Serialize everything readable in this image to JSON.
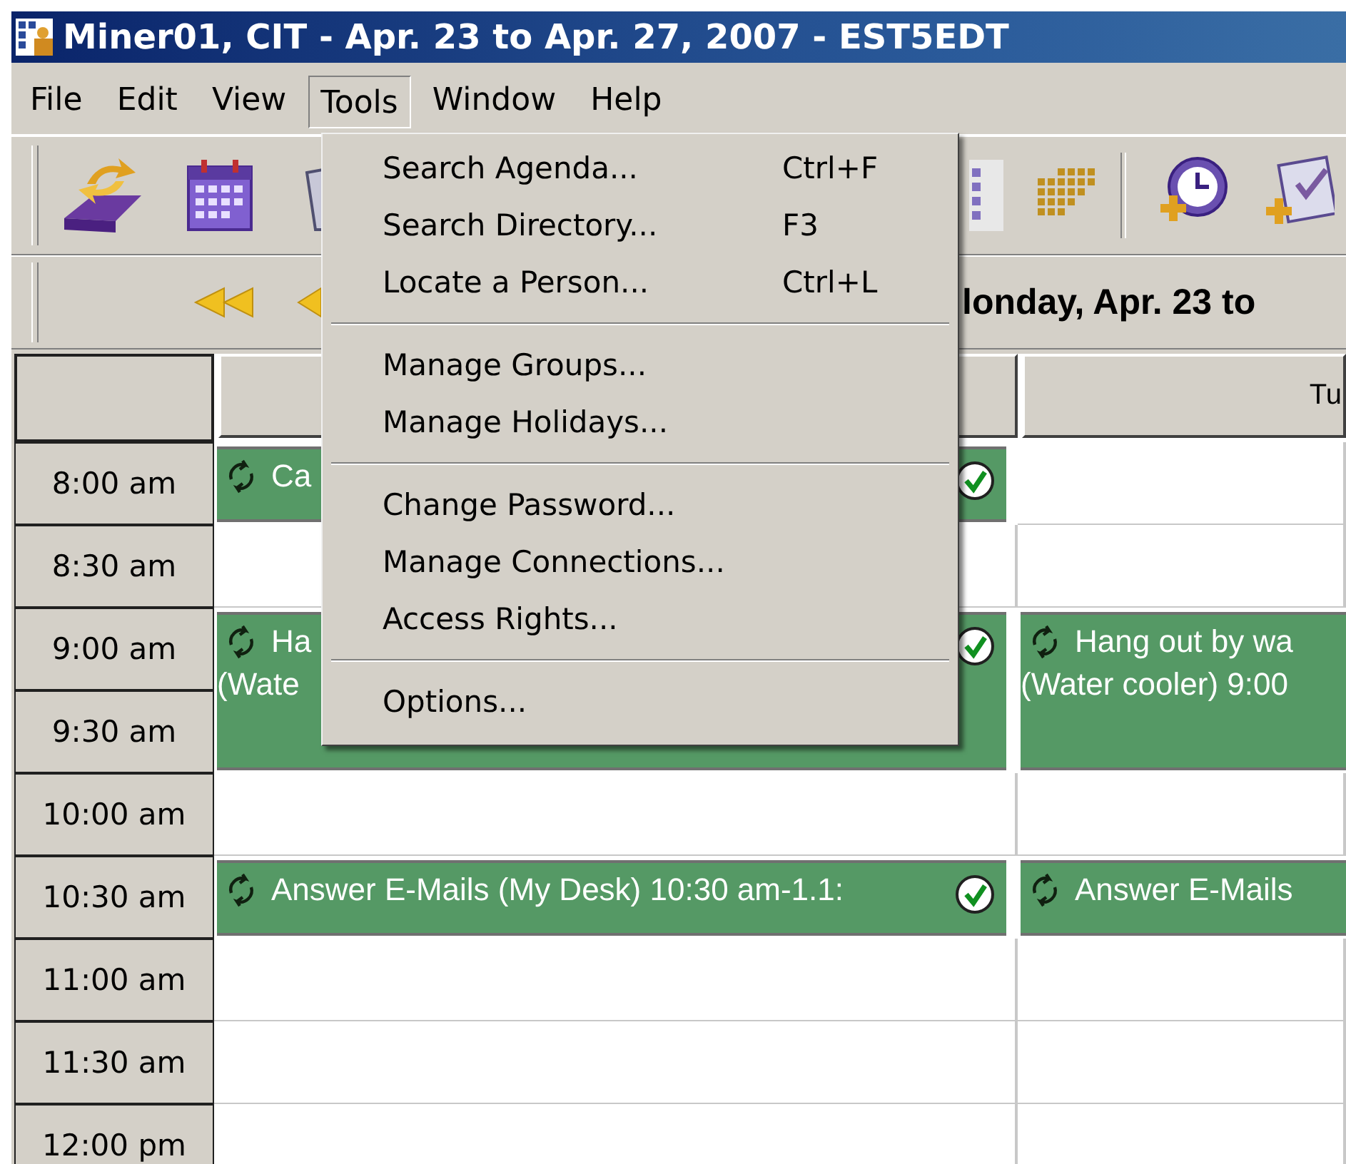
{
  "window": {
    "title": "Miner01, CIT  - Apr. 23  to Apr. 27, 2007 - EST5EDT"
  },
  "menubar": [
    {
      "label": "File",
      "selected": false
    },
    {
      "label": "Edit",
      "selected": false
    },
    {
      "label": "View",
      "selected": false
    },
    {
      "label": "Tools",
      "selected": true
    },
    {
      "label": "Window",
      "selected": false
    },
    {
      "label": "Help",
      "selected": false
    }
  ],
  "navigation": {
    "heading": "londay, Apr. 23 to"
  },
  "calendar": {
    "day_headers": [
      {
        "label": "Tu"
      }
    ],
    "rows": [
      {
        "time": "8:00 am",
        "cells": [
          {
            "kind": "event",
            "lines": [
              "Ca"
            ],
            "checked": true
          },
          {
            "kind": "empty"
          }
        ]
      },
      {
        "time": "8:30 am",
        "cells": [
          {
            "kind": "empty"
          },
          {
            "kind": "empty"
          }
        ]
      },
      {
        "time": "9:00 am",
        "cells": [
          {
            "kind": "event",
            "lines": [
              "Ha",
              "(Wate"
            ],
            "checked": true
          },
          {
            "kind": "event",
            "lines": [
              "Hang out by wa",
              "(Water cooler) 9:00"
            ],
            "checked": false
          }
        ]
      },
      {
        "time": "9:30 am",
        "cells": [
          {
            "kind": "continued"
          },
          {
            "kind": "continued"
          }
        ]
      },
      {
        "time": "10:00 am",
        "cells": [
          {
            "kind": "empty"
          },
          {
            "kind": "empty"
          }
        ]
      },
      {
        "time": "10:30 am",
        "cells": [
          {
            "kind": "event",
            "lines": [
              "Answer E-Mails (My Desk) 10:30 am-1.1:"
            ],
            "checked": true
          },
          {
            "kind": "event",
            "lines": [
              "Answer E-Mails"
            ],
            "checked": false
          }
        ]
      },
      {
        "time": "11:00 am",
        "cells": [
          {
            "kind": "empty"
          },
          {
            "kind": "empty"
          }
        ]
      },
      {
        "time": "11:30 am",
        "cells": [
          {
            "kind": "empty"
          },
          {
            "kind": "empty"
          }
        ]
      },
      {
        "time": "12:00 pm",
        "cells": [
          {
            "kind": "empty"
          },
          {
            "kind": "empty"
          }
        ]
      }
    ]
  },
  "tools_menu": {
    "groups": [
      [
        {
          "label": "Search Agenda...",
          "shortcut": "Ctrl+F"
        },
        {
          "label": "Search Directory...",
          "shortcut": "F3"
        },
        {
          "label": "Locate a Person...",
          "shortcut": "Ctrl+L"
        }
      ],
      [
        {
          "label": "Manage Groups..."
        },
        {
          "label": "Manage Holidays..."
        }
      ],
      [
        {
          "label": "Change Password..."
        },
        {
          "label": "Manage Connections..."
        },
        {
          "label": "Access Rights..."
        }
      ],
      [
        {
          "label": "Options..."
        }
      ]
    ]
  }
}
